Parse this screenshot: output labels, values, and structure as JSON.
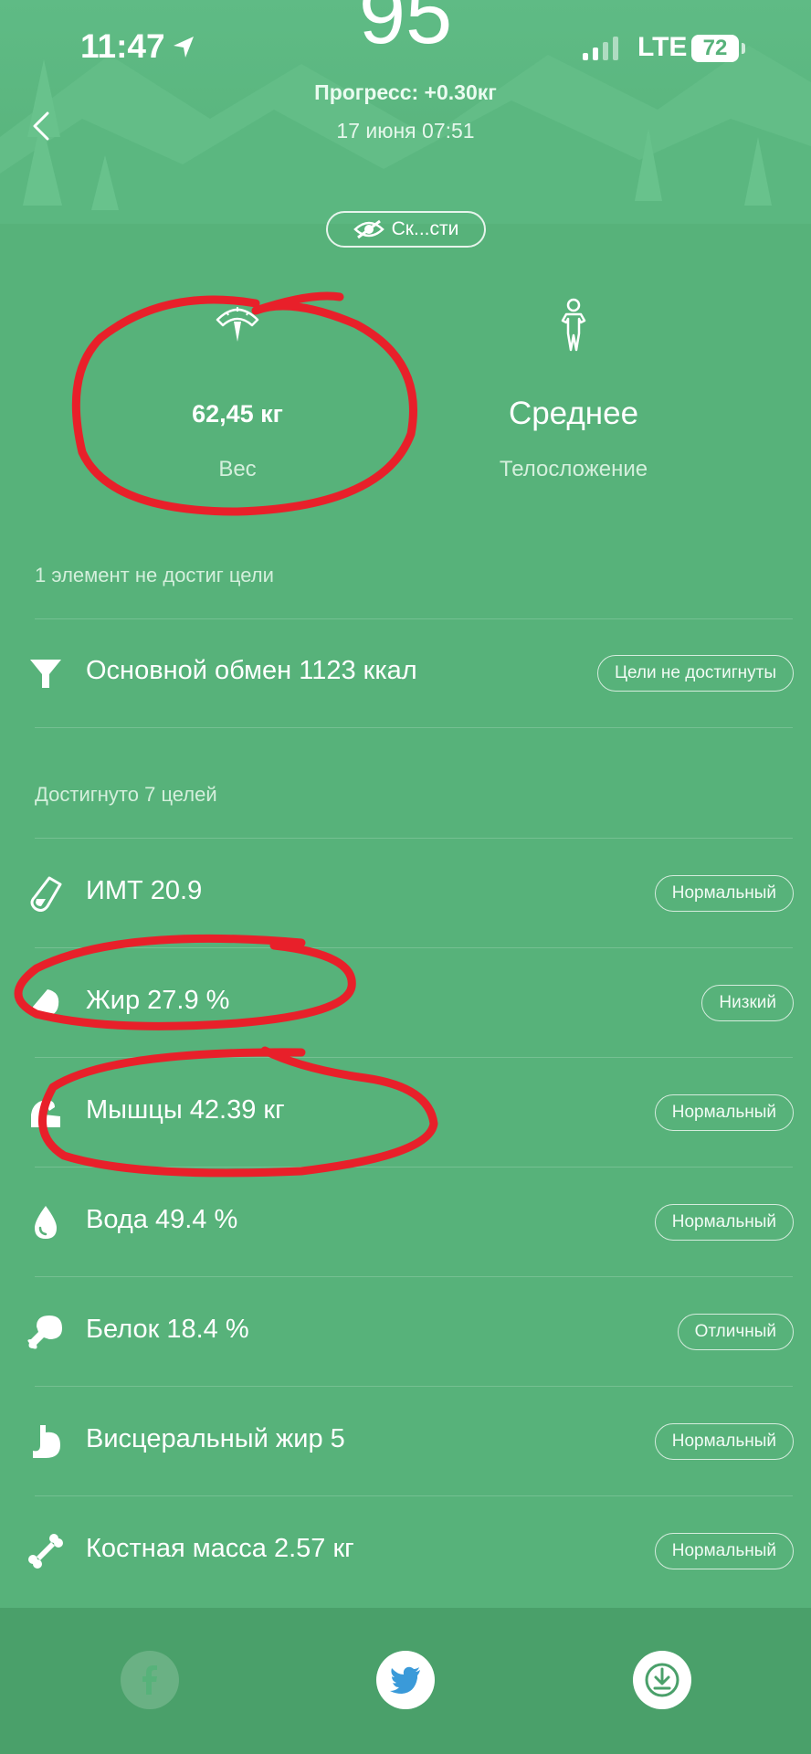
{
  "status": {
    "time": "11:47",
    "network": "LTE",
    "battery": "72"
  },
  "header": {
    "score": "95",
    "progress": "Прогресс: +0.30кг",
    "date": "17 июня 07:51",
    "hide_button": "Ск...сти"
  },
  "stats": {
    "weight": {
      "value": "62,45 кг",
      "label": "Вес",
      "icon": "scale-icon"
    },
    "body": {
      "value": "Среднее",
      "label": "Телосложение",
      "icon": "body-figure-icon"
    }
  },
  "unmet": {
    "title": "1 элемент не достиг цели",
    "items": [
      {
        "label": "Основной обмен 1123 ккал",
        "badge": "Цели не достигнуты",
        "icon": "funnel-icon"
      }
    ]
  },
  "met": {
    "title": "Достигнуто 7 целей",
    "items": [
      {
        "label": "ИМТ 20.9",
        "badge": "Нормальный",
        "icon": "flask-icon"
      },
      {
        "label": "Жир 27.9 %",
        "badge": "Низкий",
        "icon": "fat-drop-icon"
      },
      {
        "label": "Мышцы 42.39 кг",
        "badge": "Нормальный",
        "icon": "muscle-icon"
      },
      {
        "label": "Вода 49.4 %",
        "badge": "Нормальный",
        "icon": "water-drop-icon"
      },
      {
        "label": "Белок 18.4 %",
        "badge": "Отличный",
        "icon": "drumstick-icon"
      },
      {
        "label": "Висцеральный жир 5",
        "badge": "Нормальный",
        "icon": "stomach-icon"
      },
      {
        "label": "Костная масса 2.57 кг",
        "badge": "Нормальный",
        "icon": "bone-icon"
      }
    ]
  },
  "footer": {
    "share_icons": [
      "facebook-icon",
      "twitter-icon",
      "download-icon"
    ]
  },
  "colors": {
    "background": "#57b27a",
    "footer": "#4aa06a",
    "annotation": "#e8202a"
  }
}
